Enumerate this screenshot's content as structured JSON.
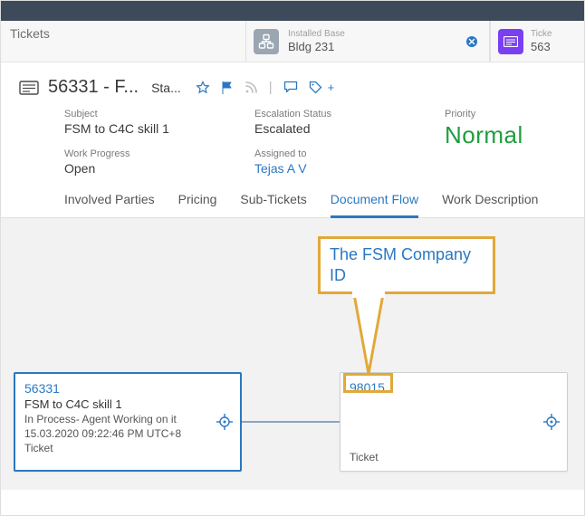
{
  "context": {
    "left_title": "Tickets",
    "pill": {
      "label": "Installed Base",
      "value": "Bldg 231"
    },
    "right": {
      "label": "Ticke",
      "value": "563"
    }
  },
  "header": {
    "title": "56331 - F...",
    "status": "Sta..."
  },
  "details": {
    "subject": {
      "label": "Subject",
      "value": "FSM to C4C skill 1"
    },
    "work_progress": {
      "label": "Work Progress",
      "value": "Open"
    },
    "escalation": {
      "label": "Escalation Status",
      "value": "Escalated"
    },
    "assigned": {
      "label": "Assigned to",
      "value": "Tejas A V"
    },
    "priority": {
      "label": "Priority",
      "value": "Normal"
    }
  },
  "tabs": {
    "involved": "Involved Parties",
    "pricing": "Pricing",
    "sub": "Sub-Tickets",
    "docflow": "Document Flow",
    "workdesc": "Work Description"
  },
  "flow": {
    "left_card": {
      "id": "56331",
      "title": "FSM to C4C skill 1",
      "status": "In Process- Agent Working on it",
      "timestamp": "15.03.2020 09:22:46 PM UTC+8",
      "type": "Ticket"
    },
    "right_card": {
      "id": "98015",
      "type": "Ticket"
    }
  },
  "callout": {
    "text_line1": "The FSM Company",
    "text_line2": "ID"
  }
}
